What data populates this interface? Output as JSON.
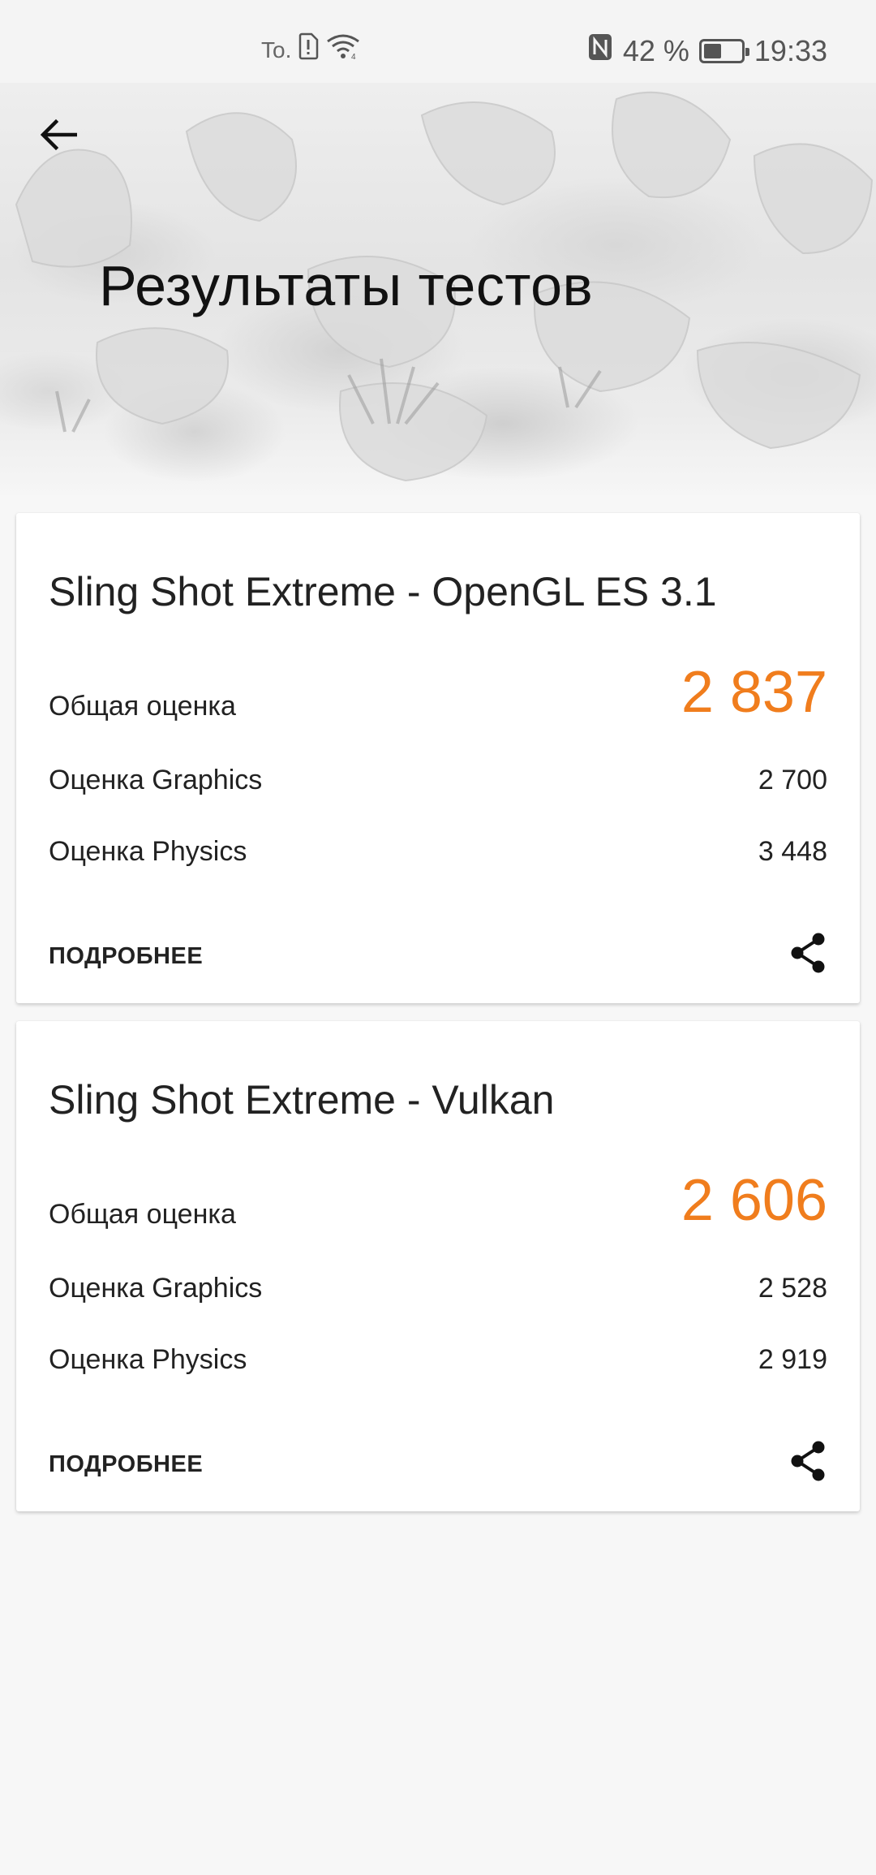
{
  "status_bar": {
    "carrier": "To.",
    "nfc_icon": "nfc-icon",
    "battery_percent_text": "42 %",
    "battery_level": 0.42,
    "time": "19:33"
  },
  "header": {
    "title": "Результаты тестов",
    "back_icon": "arrow-left-icon"
  },
  "results": [
    {
      "test_name": "Sling Shot Extreme - OpenGL ES 3.1",
      "total_label": "Общая оценка",
      "total_score": "2 837",
      "graphics_label": "Оценка Graphics",
      "graphics_score": "2 700",
      "physics_label": "Оценка Physics",
      "physics_score": "3 448",
      "details_label": "ПОДРОБНЕЕ",
      "share_icon": "share-icon"
    },
    {
      "test_name": "Sling Shot Extreme - Vulkan",
      "total_label": "Общая оценка",
      "total_score": "2 606",
      "graphics_label": "Оценка Graphics",
      "graphics_score": "2 528",
      "physics_label": "Оценка Physics",
      "physics_score": "2 919",
      "details_label": "ПОДРОБНЕЕ",
      "share_icon": "share-icon"
    }
  ],
  "colors": {
    "accent": "#f07d1d",
    "text": "#222222",
    "background": "#f7f7f7",
    "card": "#ffffff"
  }
}
